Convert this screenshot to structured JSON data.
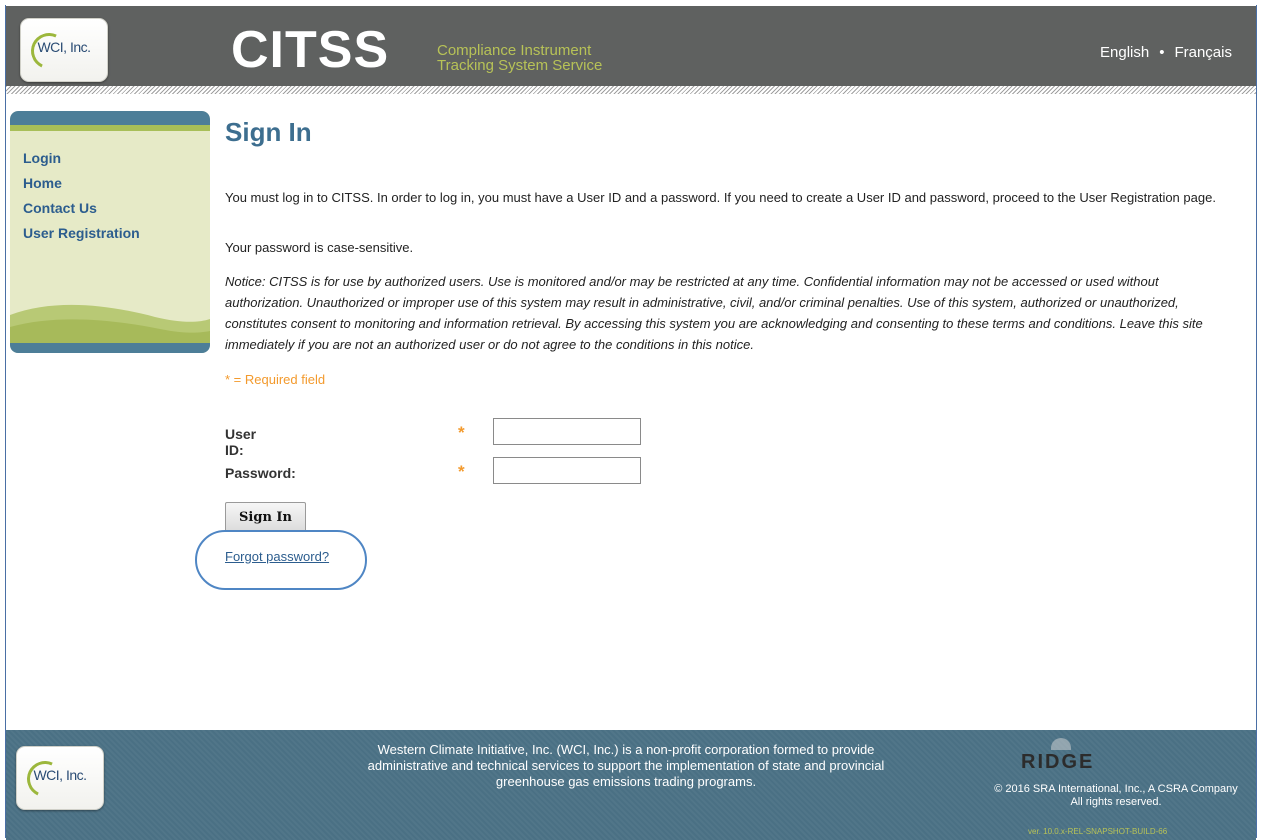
{
  "header": {
    "logo_text": "WCI, Inc.",
    "brand": "CITSS",
    "subtitle_line1": "Compliance Instrument",
    "subtitle_line2": "Tracking System Service",
    "lang_english": "English",
    "lang_separator": "•",
    "lang_french": "Français"
  },
  "sidebar": {
    "items": [
      {
        "label": "Login"
      },
      {
        "label": "Home"
      },
      {
        "label": "Contact Us"
      },
      {
        "label": "User Registration"
      }
    ]
  },
  "main": {
    "title": "Sign In",
    "intro": "You must log in to CITSS. In order to log in, you must have a User ID and a password. If you need to create a User ID and password, proceed to the User Registration page.",
    "case_note": "Your password is case-sensitive.",
    "notice": "Notice: CITSS is for use by authorized users. Use is monitored and/or may be restricted at any time. Confidential information may not be accessed or used without authorization. Unauthorized or improper use of this system may result in administrative, civil, and/or criminal penalties. Use of this system, authorized or unauthorized, constitutes consent to monitoring and information retrieval. By accessing this system you are acknowledging and consenting to these terms and conditions. Leave this site immediately if you are not an authorized user or do not agree to the conditions in this notice.",
    "required_note": "* = Required field",
    "user_id_label": "User ID:",
    "password_label": "Password:",
    "required_star": "*",
    "user_id_value": "",
    "password_value": "",
    "sign_in_button": "Sign In",
    "forgot_link": "Forgot password?"
  },
  "footer": {
    "logo_text": "WCI, Inc.",
    "description": "Western Climate Initiative, Inc. (WCI, Inc.) is a non-profit corporation formed to provide administrative and technical services to support the implementation of state and provincial greenhouse gas emissions trading programs.",
    "ridge_logo": "RIDGE",
    "copyright_line1": "© 2016 SRA International, Inc., A CSRA Company",
    "copyright_line2": "All rights reserved.",
    "version": "ver. 10.0.x-REL-SNAPSHOT-BUILD-66"
  },
  "colors": {
    "header_bg": "#5f6160",
    "accent_green": "#b7c257",
    "title_blue": "#3d6e8f",
    "link_blue": "#2c5d8e",
    "required_orange": "#f39a2d",
    "footer_bg": "#4a7084"
  }
}
